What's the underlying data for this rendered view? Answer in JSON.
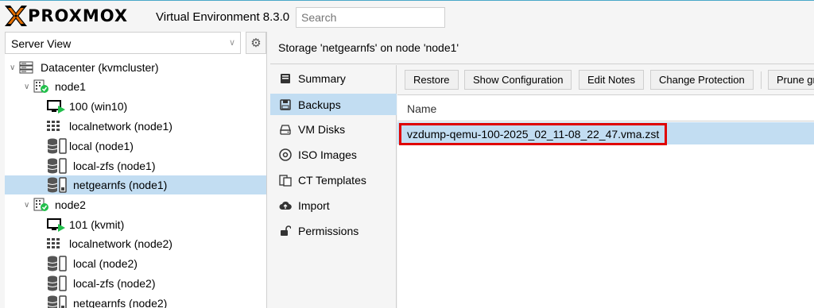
{
  "header": {
    "logo_text": "PROXMOX",
    "subtitle": "Virtual Environment 8.3.0",
    "search_placeholder": "Search"
  },
  "left_panel": {
    "view_select": "Server View",
    "tree": [
      {
        "label": "Datacenter (kvmcluster)",
        "icon": "datacenter-icon"
      },
      {
        "label": "node1",
        "icon": "node-online-icon"
      },
      {
        "label": "100 (win10)",
        "icon": "vm-running-icon"
      },
      {
        "label": "localnetwork (node1)",
        "icon": "network-grid-icon"
      },
      {
        "label": "local (node1)",
        "icon": "storage-icon"
      },
      {
        "label": "local-zfs (node1)",
        "icon": "storage-icon"
      },
      {
        "label": "netgearnfs (node1)",
        "icon": "storage-icon",
        "selected": true
      },
      {
        "label": "node2",
        "icon": "node-online-icon"
      },
      {
        "label": "101 (kvmit)",
        "icon": "vm-running-icon"
      },
      {
        "label": "localnetwork (node2)",
        "icon": "network-grid-icon"
      },
      {
        "label": "local (node2)",
        "icon": "storage-icon"
      },
      {
        "label": "local-zfs (node2)",
        "icon": "storage-icon"
      },
      {
        "label": "netgearnfs (node2)",
        "icon": "storage-icon"
      }
    ]
  },
  "main": {
    "title": "Storage 'netgearnfs' on node 'node1'",
    "nav": [
      {
        "label": "Summary",
        "icon": "book-icon"
      },
      {
        "label": "Backups",
        "icon": "floppy-icon",
        "selected": true
      },
      {
        "label": "VM Disks",
        "icon": "hdd-icon"
      },
      {
        "label": "ISO Images",
        "icon": "disc-icon"
      },
      {
        "label": "CT Templates",
        "icon": "template-icon"
      },
      {
        "label": "Import",
        "icon": "cloud-upload-icon"
      },
      {
        "label": "Permissions",
        "icon": "unlock-icon"
      }
    ],
    "toolbar": {
      "restore": "Restore",
      "show_config": "Show Configuration",
      "edit_notes": "Edit Notes",
      "change_protection": "Change Protection",
      "prune": "Prune gr"
    },
    "table": {
      "column_name": "Name",
      "rows": [
        "vzdump-qemu-100-2025_02_11-08_22_47.vma.zst"
      ]
    }
  },
  "colors": {
    "selection": "#c2ddf2",
    "highlight_border": "#e00000",
    "brand_orange": "#e57000",
    "running_green": "#21bf4b"
  }
}
